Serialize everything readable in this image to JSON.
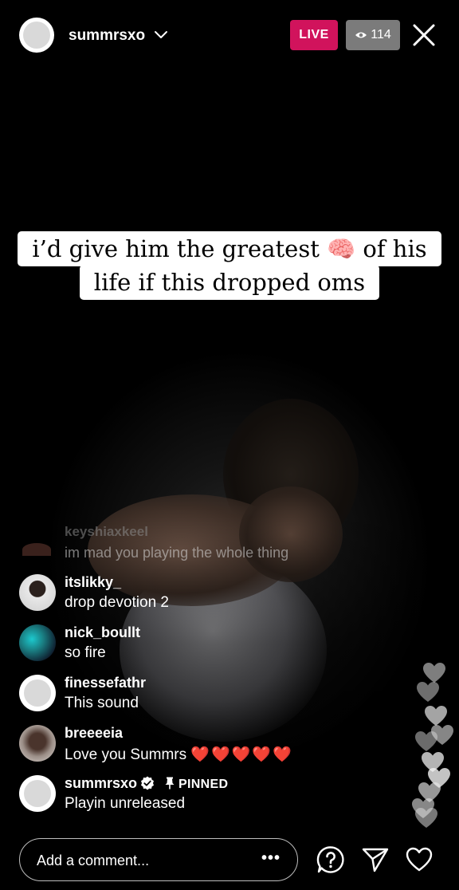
{
  "header": {
    "username": "summrsxo",
    "live_label": "LIVE",
    "viewer_count": "114"
  },
  "caption": {
    "line1": "i’d give him the greatest 🧠 of his",
    "line2": "life if this dropped oms"
  },
  "comments": [
    {
      "user": "keyshiaxkeel",
      "text": "im mad you playing the whole thing",
      "faded": true
    },
    {
      "user": "itslikky_",
      "text": "drop devotion 2"
    },
    {
      "user": "nick_boullt",
      "text": "so fire"
    },
    {
      "user": "finessefathr",
      "text": "This sound"
    },
    {
      "user": "breeeeia",
      "text": "Love you Summrs",
      "emoji": "❤️❤️❤️❤️❤️"
    },
    {
      "user": "summrsxo",
      "text": "Playin unreleased",
      "pinned_label": "PINNED",
      "verified": true
    }
  ],
  "comment_input": {
    "placeholder": "Add a comment...",
    "more_label": "•••"
  },
  "icons": {
    "chevron": "chevron-down-icon",
    "eye": "eye-icon",
    "close": "close-icon",
    "verified": "verified-icon",
    "pin": "pin-icon",
    "question": "question-icon",
    "send": "send-icon",
    "like": "heart-icon"
  },
  "colors": {
    "live_badge": "#d1135c",
    "viewer_badge": "#7b7b7b",
    "caption_bg": "#ffffff",
    "heart_red": "#e02030"
  }
}
